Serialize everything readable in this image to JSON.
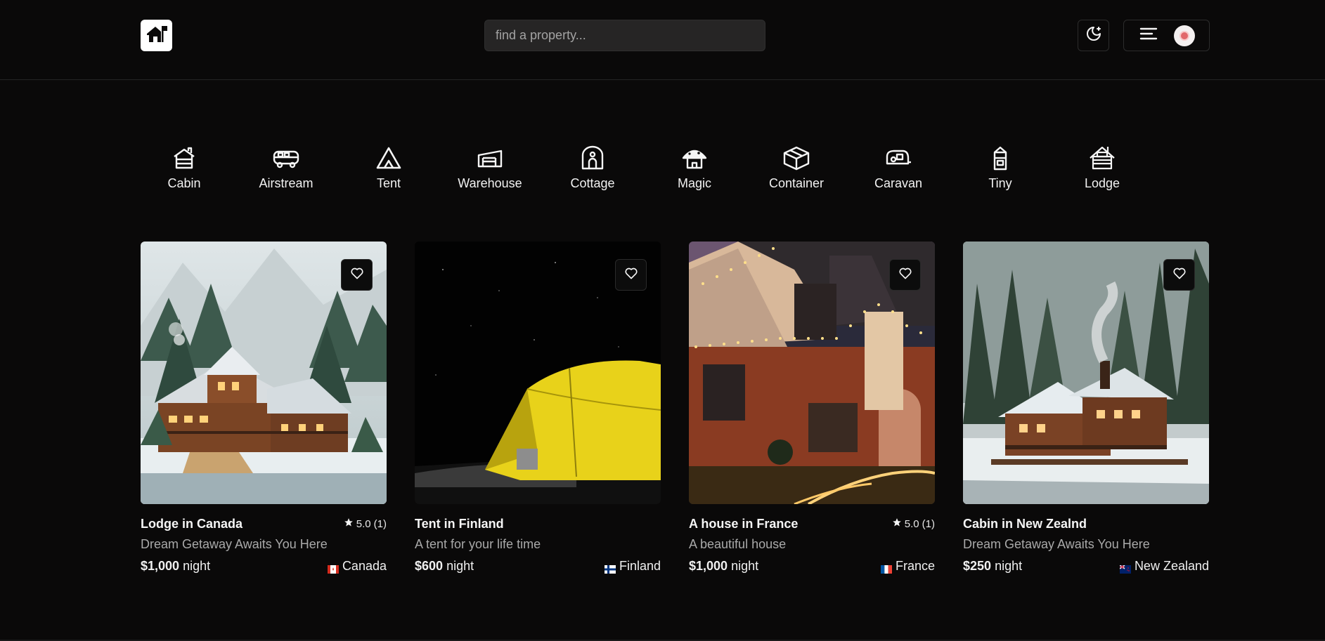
{
  "header": {
    "logo_icon": "house-flag-icon",
    "search_placeholder": "find a property...",
    "theme_toggle_icon": "moon-stars-icon",
    "menu_icon": "hamburger-icon",
    "avatar_icon": "user-avatar"
  },
  "categories": [
    {
      "label": "Cabin",
      "icon": "cabin-icon"
    },
    {
      "label": "Airstream",
      "icon": "airstream-icon"
    },
    {
      "label": "Tent",
      "icon": "tent-icon"
    },
    {
      "label": "Warehouse",
      "icon": "warehouse-icon"
    },
    {
      "label": "Cottage",
      "icon": "cottage-icon"
    },
    {
      "label": "Magic",
      "icon": "mushroom-house-icon"
    },
    {
      "label": "Container",
      "icon": "container-icon"
    },
    {
      "label": "Caravan",
      "icon": "caravan-icon"
    },
    {
      "label": "Tiny",
      "icon": "tiny-house-icon"
    },
    {
      "label": "Lodge",
      "icon": "lodge-icon"
    }
  ],
  "listings": [
    {
      "title": "Lodge in Canada",
      "rating": "5.0",
      "reviews": "(1)",
      "description": "Dream Getaway Awaits You Here",
      "price": "$1,000",
      "unit": "night",
      "country": "Canada",
      "flag": "ca",
      "image": "snowy lodge by lake"
    },
    {
      "title": "Tent in Finland",
      "rating": "",
      "reviews": "",
      "description": "A tent for your life time",
      "price": "$600",
      "unit": "night",
      "country": "Finland",
      "flag": "fi",
      "image": "yellow tent at night"
    },
    {
      "title": "A house in France",
      "rating": "5.0",
      "reviews": "(1)",
      "description": "A beautiful house",
      "price": "$1,000",
      "unit": "night",
      "country": "France",
      "flag": "fr",
      "image": "brick house with lights"
    },
    {
      "title": "Cabin in New Zealnd",
      "rating": "",
      "reviews": "",
      "description": "Dream Getaway Awaits You Here",
      "price": "$250",
      "unit": "night",
      "country": "New Zealand",
      "flag": "nz",
      "image": "snowy cabin in forest"
    }
  ],
  "colors": {
    "background": "#0a0909",
    "surface": "#262525",
    "text": "#f5f5f5",
    "muted": "#a9a9a9"
  }
}
